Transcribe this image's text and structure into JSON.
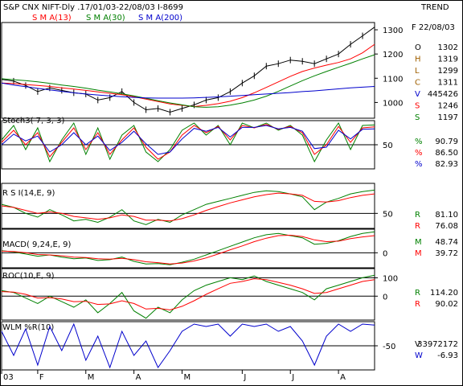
{
  "header": {
    "title": "S&P CNX NIFT-Dly .17/01/03-22/08/03 I-8699",
    "trend": "TREND",
    "date": "F 22/08/03"
  },
  "colors": {
    "price": "#000000",
    "sma13": "#ff0000",
    "sma30": "#008000",
    "sma200": "#0000cc",
    "volume": "#0000cc",
    "ohlc_label": "#a06000",
    "frame": "#000000"
  },
  "chart_data": [
    {
      "panel": "price",
      "type": "line",
      "x": [
        "2003-01-17",
        "2003-01-24",
        "2003-01-31",
        "2003-02-07",
        "2003-02-14",
        "2003-02-21",
        "2003-02-28",
        "2003-03-07",
        "2003-03-14",
        "2003-03-21",
        "2003-03-28",
        "2003-04-04",
        "2003-04-11",
        "2003-04-18",
        "2003-04-25",
        "2003-05-02",
        "2003-05-09",
        "2003-05-16",
        "2003-05-23",
        "2003-05-30",
        "2003-06-06",
        "2003-06-13",
        "2003-06-20",
        "2003-06-27",
        "2003-07-04",
        "2003-07-11",
        "2003-07-18",
        "2003-07-25",
        "2003-08-01",
        "2003-08-08",
        "2003-08-15",
        "2003-08-22"
      ],
      "legend": [
        "S M A(13)",
        "S M A(30)",
        "S M A(200)"
      ],
      "series": [
        {
          "name": "price",
          "values": [
            1095,
            1088,
            1070,
            1045,
            1060,
            1050,
            1040,
            1035,
            1010,
            1020,
            1045,
            1000,
            970,
            975,
            960,
            975,
            990,
            1010,
            1020,
            1045,
            1080,
            1110,
            1150,
            1160,
            1175,
            1170,
            1160,
            1180,
            1200,
            1240,
            1275,
            1311
          ]
        },
        {
          "name": "S M A(13)",
          "values": [
            1080,
            1078,
            1074,
            1070,
            1066,
            1060,
            1055,
            1050,
            1044,
            1038,
            1032,
            1024,
            1014,
            1004,
            994,
            988,
            983,
            988,
            995,
            1005,
            1020,
            1040,
            1062,
            1085,
            1108,
            1128,
            1142,
            1154,
            1165,
            1180,
            1205,
            1240
          ]
        },
        {
          "name": "S M A(30)",
          "values": [
            1098,
            1094,
            1090,
            1085,
            1079,
            1072,
            1066,
            1059,
            1051,
            1044,
            1036,
            1027,
            1017,
            1007,
            998,
            990,
            982,
            980,
            982,
            989,
            998,
            1010,
            1026,
            1046,
            1068,
            1090,
            1110,
            1128,
            1145,
            1162,
            1180,
            1197
          ]
        },
        {
          "name": "S M A(200)",
          "values": [
            1080,
            1072,
            1065,
            1058,
            1052,
            1046,
            1040,
            1035,
            1031,
            1027,
            1024,
            1021,
            1019,
            1018,
            1018,
            1018,
            1019,
            1021,
            1023,
            1026,
            1029,
            1032,
            1035,
            1038,
            1041,
            1045,
            1048,
            1052,
            1056,
            1060,
            1063,
            1066
          ]
        }
      ],
      "yticks": [
        1000,
        1100,
        1200,
        1300
      ],
      "ylim": [
        935,
        1330
      ],
      "readouts": [
        {
          "label": "O",
          "value": "1302"
        },
        {
          "label": "H",
          "value": "1319"
        },
        {
          "label": "L",
          "value": "1299"
        },
        {
          "label": "C",
          "value": "1311"
        },
        {
          "label": "V",
          "value": "445426"
        },
        {
          "label": "S",
          "value": "1246"
        },
        {
          "label": "S",
          "value": "1197"
        }
      ]
    },
    {
      "panel": "stochastic",
      "type": "line",
      "title": "Stoch3( 7, 3, 3)",
      "series": [
        {
          "name": "%K",
          "values": [
            60,
            90,
            40,
            85,
            15,
            60,
            95,
            30,
            85,
            20,
            70,
            90,
            35,
            15,
            40,
            80,
            95,
            70,
            90,
            50,
            95,
            85,
            95,
            80,
            90,
            70,
            15,
            60,
            95,
            40,
            90,
            91
          ]
        },
        {
          "name": "%D",
          "values": [
            55,
            80,
            50,
            75,
            25,
            55,
            85,
            40,
            75,
            30,
            60,
            85,
            45,
            20,
            35,
            70,
            90,
            75,
            88,
            60,
            90,
            85,
            92,
            82,
            88,
            75,
            30,
            50,
            88,
            55,
            85,
            87
          ]
        },
        {
          "name": "%D2",
          "values": [
            50,
            72,
            58,
            68,
            35,
            50,
            75,
            50,
            68,
            38,
            55,
            78,
            52,
            30,
            35,
            62,
            84,
            78,
            86,
            66,
            86,
            86,
            90,
            83,
            86,
            78,
            42,
            45,
            80,
            62,
            82,
            83
          ]
        }
      ],
      "yticks": [
        50
      ],
      "ylim": [
        0,
        100
      ],
      "readouts": [
        {
          "label": "%",
          "value": "90.79"
        },
        {
          "label": "%",
          "value": "86.50"
        },
        {
          "label": "%",
          "value": "82.93"
        }
      ]
    },
    {
      "panel": "rsi",
      "type": "line",
      "title": "R S I(14,E, 9)",
      "series": [
        {
          "name": "RSI",
          "values": [
            62,
            58,
            50,
            45,
            55,
            48,
            40,
            42,
            38,
            45,
            55,
            40,
            35,
            42,
            38,
            48,
            55,
            62,
            66,
            70,
            74,
            78,
            80,
            79,
            76,
            72,
            55,
            65,
            70,
            76,
            79,
            81
          ]
        },
        {
          "name": "Signal",
          "values": [
            60,
            58,
            54,
            50,
            52,
            50,
            46,
            44,
            42,
            44,
            48,
            46,
            41,
            41,
            40,
            43,
            48,
            54,
            59,
            64,
            68,
            72,
            75,
            77,
            76,
            74,
            66,
            65,
            67,
            71,
            74,
            76
          ]
        }
      ],
      "yticks": [
        50
      ],
      "ylim": [
        30,
        90
      ],
      "readouts": [
        {
          "label": "R",
          "value": "81.10"
        },
        {
          "label": "R",
          "value": "76.08"
        }
      ]
    },
    {
      "panel": "macd",
      "type": "line",
      "title": "MACD( 9,24,E, 9)",
      "series": [
        {
          "name": "MACD",
          "values": [
            5,
            2,
            -3,
            -8,
            -5,
            -10,
            -14,
            -12,
            -18,
            -16,
            -10,
            -20,
            -26,
            -25,
            -28,
            -22,
            -15,
            -5,
            5,
            15,
            25,
            35,
            42,
            45,
            40,
            35,
            20,
            22,
            28,
            38,
            45,
            49
          ]
        },
        {
          "name": "Signal",
          "values": [
            4,
            3,
            0,
            -4,
            -5,
            -7,
            -10,
            -11,
            -14,
            -15,
            -13,
            -16,
            -21,
            -23,
            -26,
            -24,
            -19,
            -12,
            -3,
            7,
            16,
            26,
            34,
            40,
            41,
            38,
            30,
            26,
            27,
            33,
            37,
            40
          ]
        }
      ],
      "yticks": [
        0
      ],
      "ylim": [
        -35,
        55
      ],
      "readouts": [
        {
          "label": "M",
          "value": "48.74"
        },
        {
          "label": "M",
          "value": "39.72"
        }
      ]
    },
    {
      "panel": "roc",
      "type": "line",
      "title": "ROC(10,E, 9)",
      "series": [
        {
          "name": "ROC",
          "values": [
            30,
            20,
            -10,
            -40,
            0,
            -30,
            -60,
            -20,
            -90,
            -40,
            20,
            -80,
            -120,
            -60,
            -90,
            -20,
            30,
            60,
            80,
            100,
            90,
            110,
            80,
            60,
            40,
            20,
            -20,
            40,
            60,
            80,
            100,
            114
          ]
        },
        {
          "name": "Signal",
          "values": [
            25,
            22,
            10,
            -10,
            -8,
            -15,
            -30,
            -28,
            -45,
            -42,
            -25,
            -40,
            -70,
            -66,
            -75,
            -55,
            -25,
            10,
            40,
            70,
            80,
            95,
            90,
            75,
            60,
            40,
            15,
            20,
            40,
            60,
            80,
            90
          ]
        }
      ],
      "yticks": [
        0,
        100
      ],
      "ylim": [
        -130,
        150
      ],
      "readouts": [
        {
          "label": "R",
          "value": "114.20"
        },
        {
          "label": "R",
          "value": "90.02"
        }
      ]
    },
    {
      "panel": "williams",
      "type": "line",
      "title": "WLM %R(10)",
      "series": [
        {
          "name": "%R",
          "values": [
            -20,
            -70,
            -15,
            -90,
            -10,
            -60,
            -5,
            -80,
            -30,
            -95,
            -20,
            -70,
            -40,
            -95,
            -60,
            -20,
            -5,
            -10,
            -5,
            -30,
            -5,
            -10,
            -5,
            -20,
            -10,
            -40,
            -90,
            -30,
            -5,
            -20,
            -5,
            -7
          ]
        }
      ],
      "yticks": [
        -50
      ],
      "ylim": [
        -100,
        0
      ],
      "readouts": [
        {
          "label": "V",
          "value": "33972172"
        },
        {
          "label": "W",
          "value": "-6.93"
        }
      ]
    }
  ],
  "x_axis": {
    "labels": [
      "03",
      "F",
      "M",
      "A",
      "M",
      "J",
      "J",
      "A"
    ],
    "positions": [
      0,
      3,
      7,
      11,
      15,
      20,
      24,
      28
    ]
  }
}
